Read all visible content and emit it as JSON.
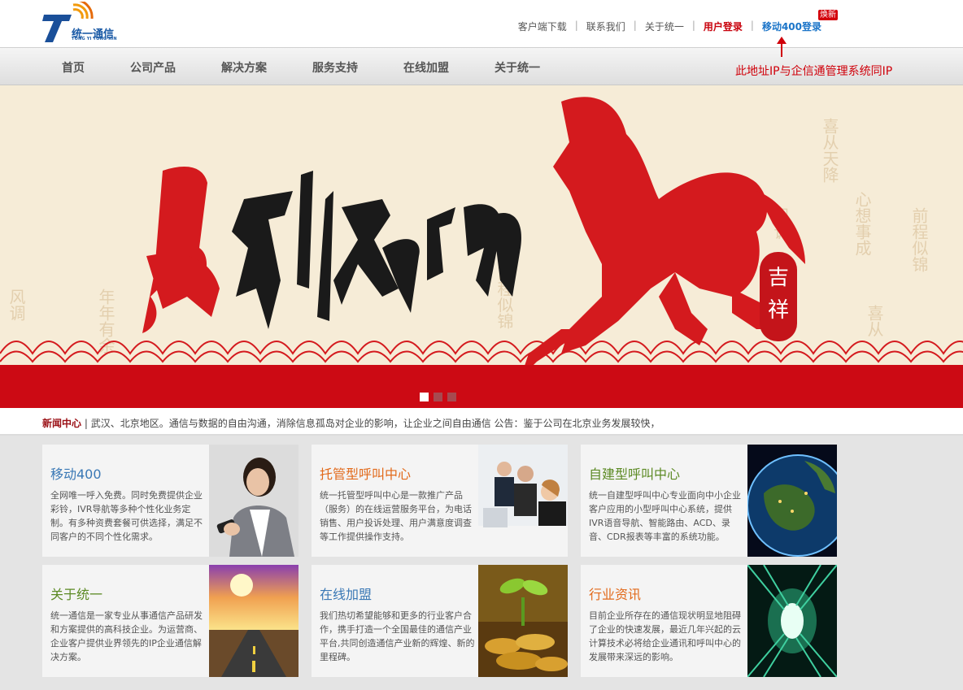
{
  "logo": {
    "brand_cn": "统一通信",
    "brand_en": "TONG YI TONG XIN",
    "mark": "7"
  },
  "toplinks": {
    "download": "客户端下载",
    "contact": "联系我们",
    "about": "关于统一",
    "user_login": "用户登录",
    "mobile400_login": "移动400登录",
    "badge": "焕新",
    "separator": "|"
  },
  "annotation": {
    "note": "此地址IP与企信通管理系统同IP"
  },
  "nav": {
    "items": [
      {
        "label": "首页"
      },
      {
        "label": "公司产品"
      },
      {
        "label": "解决方案"
      },
      {
        "label": "服务支持"
      },
      {
        "label": "在线加盟"
      },
      {
        "label": "关于统一"
      }
    ]
  },
  "banner": {
    "calligraphy": "马到成功",
    "seal": "吉祥",
    "slide_count": 3,
    "active_slide": 1
  },
  "news": {
    "title": "新闻中心",
    "separator": "|",
    "text": "武汉、北京地区。通信与数据的自由沟通，消除信息孤岛对企业的影响，让企业之间自由通信  公告：鉴于公司在北京业务发展较快，"
  },
  "cards": [
    {
      "title": "移动400",
      "color": "blue",
      "desc": "全网唯一呼入免费。同时免费提供企业彩铃，IVR导航等多种个性化业务定制。有多种资费套餐可供选择，满足不同客户的不同个性化需求。"
    },
    {
      "title": "托管型呼叫中心",
      "color": "orange",
      "desc": "统一托管型呼叫中心是一款推广产品（服务）的在线运营服务平台，为电话销售、用户投诉处理、用户满意度调查等工作提供操作支持。"
    },
    {
      "title": "自建型呼叫中心",
      "color": "green",
      "desc": "统一自建型呼叫中心专业面向中小企业客户应用的小型呼叫中心系统，提供IVR语音导航、智能路由、ACD、录音、CDR报表等丰富的系统功能。"
    },
    {
      "title": "关于统一",
      "color": "green",
      "desc": "统一通信是一家专业从事通信产品研发和方案提供的高科技企业。为运营商、企业客户提供业界领先的IP企业通信解决方案。"
    },
    {
      "title": "在线加盟",
      "color": "blue",
      "desc": "我们热切希望能够和更多的行业客户合作，携手打造一个全国最佳的通信产业平台,共同创造通信产业新的辉煌、新的里程碑。"
    },
    {
      "title": "行业资讯",
      "color": "orange",
      "desc": "目前企业所存在的通信现状明显地阻碍了企业的快速发展，最近几年兴起的云计算技术必将给企业通讯和呼叫中心的发展带来深远的影响。"
    }
  ],
  "colors": {
    "brand_blue": "#1a5aa6",
    "link_red": "#c8000b",
    "link_blue": "#1a74c8",
    "banner_red": "#cc0a14",
    "banner_bg": "#f6ecd7",
    "news_title": "#9a0e14",
    "card_blue": "#3a78b5",
    "card_orange": "#e26a1b",
    "card_green": "#5c8a24"
  }
}
